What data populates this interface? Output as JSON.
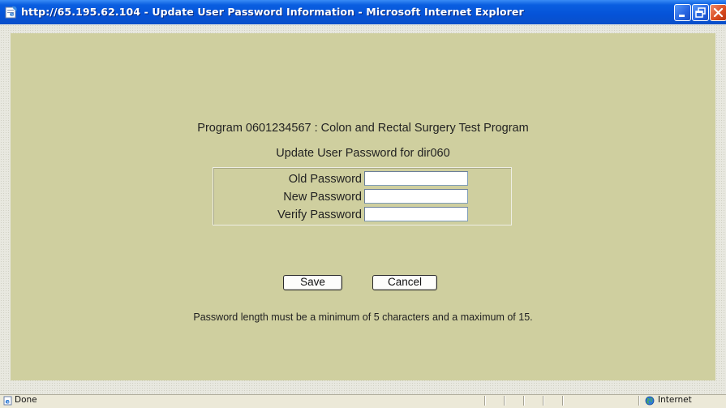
{
  "window": {
    "title": "http://65.195.62.104 - Update User Password Information - Microsoft Internet Explorer",
    "controls": [
      "minimize-icon",
      "restore-icon",
      "close-icon"
    ],
    "title_bar_color": "#0553d8"
  },
  "page": {
    "program_line": "Program 0601234567 : Colon and Rectal Surgery Test Program",
    "heading": "Update User Password for dir060",
    "background_color": "#cfcf9f",
    "form": {
      "old_password_label": "Old Password",
      "old_password_value": "",
      "new_password_label": "New Password",
      "new_password_value": "",
      "verify_password_label": "Verify Password",
      "verify_password_value": ""
    },
    "save_label": "Save",
    "cancel_label": "Cancel",
    "note": "Password length must be a minimum of 5 characters and a maximum of 15."
  },
  "statusbar": {
    "status": "Done",
    "zone": "Internet"
  }
}
